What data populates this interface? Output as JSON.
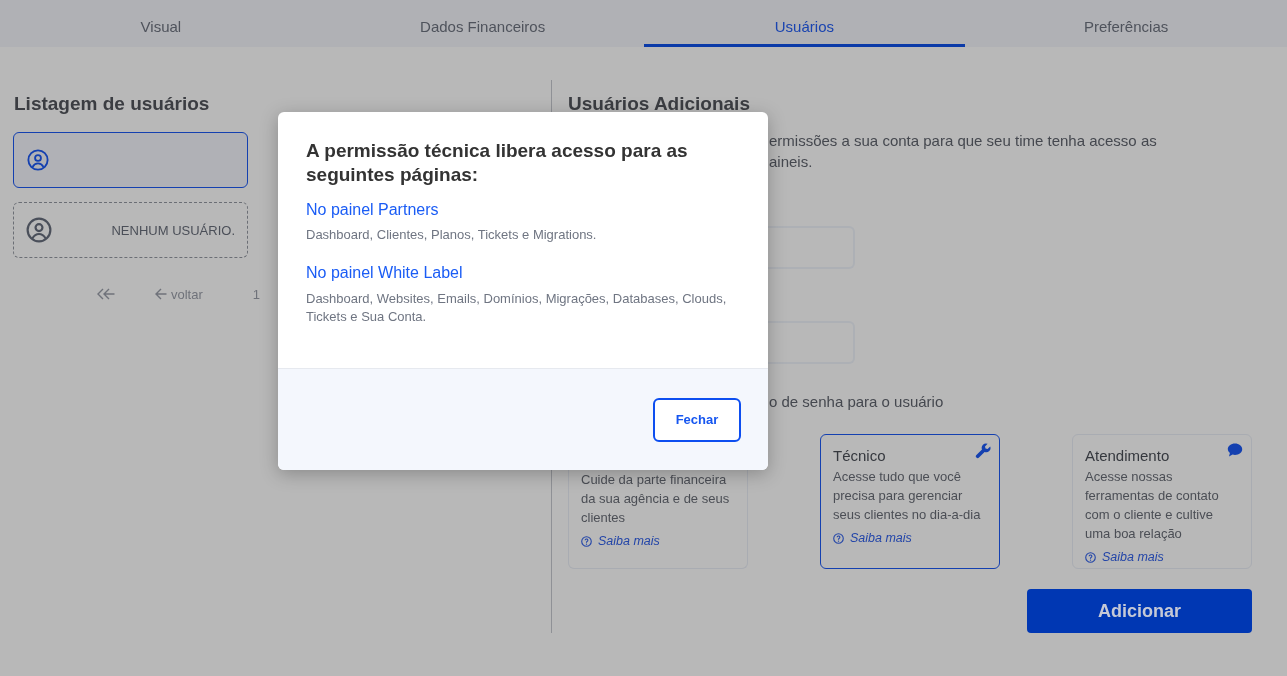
{
  "tabs": [
    {
      "label": "Visual",
      "selected": false
    },
    {
      "label": "Dados Financeiros",
      "selected": false
    },
    {
      "label": "Usuários",
      "selected": true
    },
    {
      "label": "Preferências",
      "selected": false
    }
  ],
  "user_list": {
    "title": "Listagem de usuários",
    "items": [
      {
        "kind": "user",
        "selected": true
      },
      {
        "kind": "empty",
        "label": "NENHUM USUÁRIO.",
        "selected": false
      }
    ],
    "pagination": {
      "first": {
        "disabled": true
      },
      "previous": {
        "label": "voltar",
        "disabled": true
      },
      "page": "1"
    }
  },
  "additional_users": {
    "title": "Usuários Adicionais",
    "description_lines": [
      "ermissões a sua conta para que seu time tenha acesso as",
      "aineis."
    ],
    "password_option": "o de senha para o usuário",
    "roles": [
      {
        "kind": "covered",
        "description": "Cuide da parte financeira da sua agência e de seus clientes",
        "link": "Saiba mais",
        "selected": false
      },
      {
        "kind": "technical",
        "title": "Técnico",
        "description": "Acesse tudo que você precisa para gerenciar seus clientes no dia-a-dia",
        "link": "Saiba mais",
        "selected": true
      },
      {
        "kind": "support",
        "title": "Atendimento",
        "description": "Acesse nossas ferramentas de contato com o cliente e cultive uma boa relação",
        "link": "Saiba mais",
        "selected": false
      }
    ],
    "add_button": "Adicionar"
  },
  "modal": {
    "title": "A permissão técnica libera acesso para as seguintes páginas:",
    "sections": [
      {
        "heading": "No painel Partners",
        "pages": "Dashboard, Clientes, Planos, Tickets e Migrations."
      },
      {
        "heading": "No painel White Label",
        "pages": "Dashboard, Websites, Emails, Domínios, Migrações, Databases, Clouds, Tickets e Sua Conta."
      }
    ],
    "close_button": "Fechar"
  }
}
